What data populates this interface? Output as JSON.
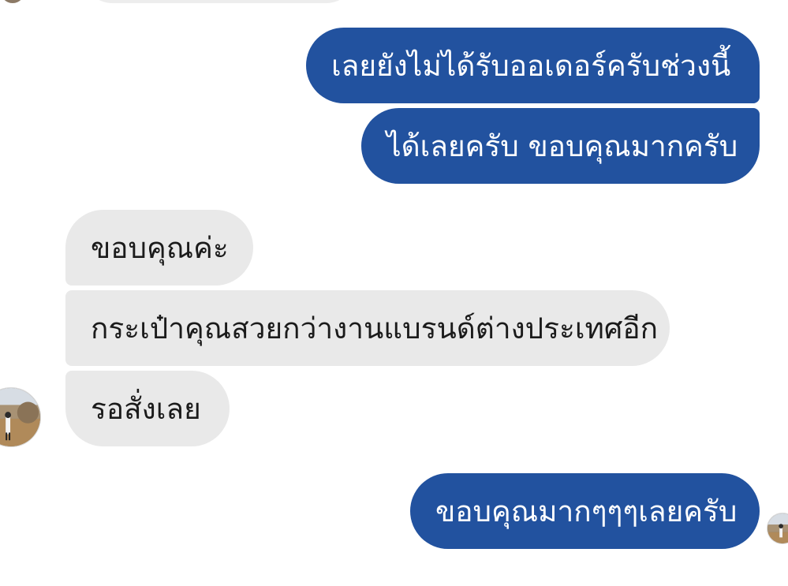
{
  "colors": {
    "outgoing_bubble": "#22529f",
    "outgoing_text": "#ffffff",
    "incoming_bubble": "#e9e9e9",
    "incoming_text": "#1b1b1b"
  },
  "messages": [
    {
      "sender": "me",
      "text": "เลยยังไม่ได้รับออเดอร์ครับช่วงนี้"
    },
    {
      "sender": "me",
      "text": "ได้เลยครับ ขอบคุณมากครับ"
    },
    {
      "sender": "contact",
      "text": "ขอบคุณค่ะ"
    },
    {
      "sender": "contact",
      "text": "กระเป๋าคุณสวยกว่างานแบรนด์ต่างประเทศอีก"
    },
    {
      "sender": "contact",
      "text": "รอสั่งเลย"
    },
    {
      "sender": "me",
      "text": "ขอบคุณมากๆๆๆเลยครับ"
    }
  ],
  "avatars": {
    "contact": "contact-avatar-photo",
    "me": "my-avatar-photo"
  }
}
